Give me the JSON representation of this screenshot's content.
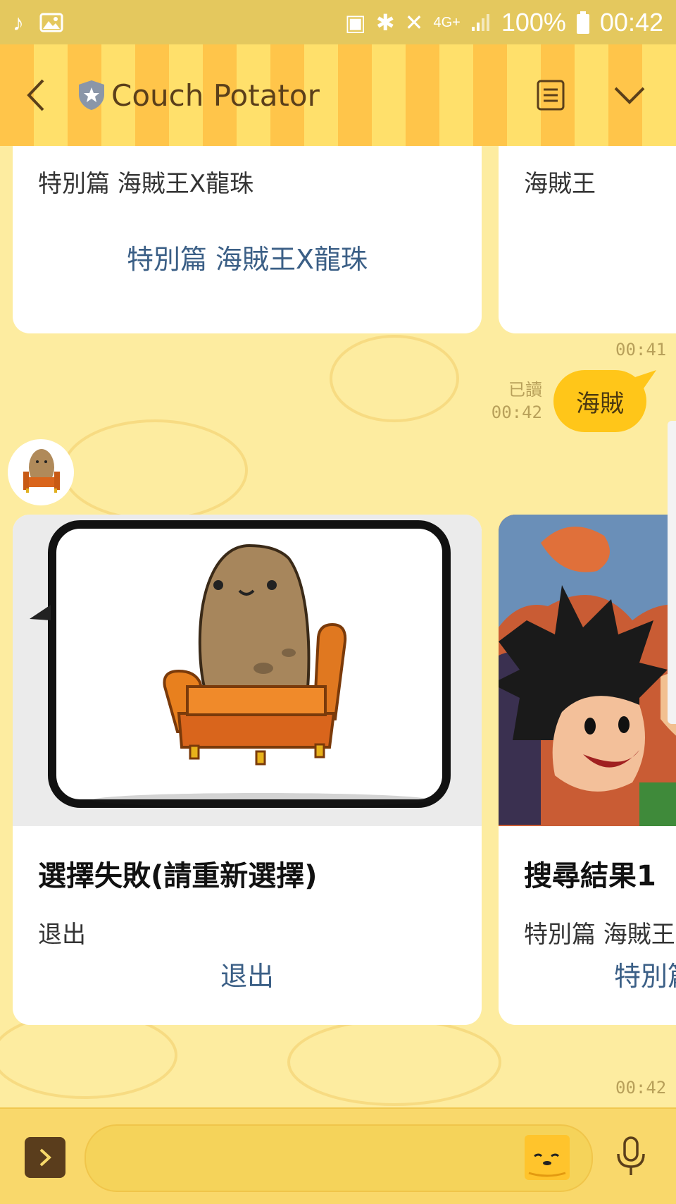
{
  "status_bar": {
    "network": "4G+",
    "battery": "100%",
    "time": "00:42"
  },
  "header": {
    "title": "Couch Potator"
  },
  "chat": {
    "top_cards": [
      {
        "text": "特別篇 海賊王X龍珠",
        "link": "特別篇 海賊王X龍珠"
      },
      {
        "text": "海賊王"
      }
    ],
    "timestamp_1": "00:41",
    "user_message": {
      "read_label": "已讀",
      "time": "00:42",
      "text": "海賊"
    },
    "carousel_cards": [
      {
        "title": "選擇失敗(請重新選擇)",
        "text": "退出",
        "link": "退出"
      },
      {
        "title": "搜尋結果1",
        "text": "特別篇 海賊王X龍珠",
        "link": "特別篇 海賊王X龍珠"
      }
    ],
    "timestamp_2": "00:42"
  },
  "colors": {
    "background": "#fdeca0",
    "status_bar": "#e4c85e",
    "bubble": "#ffc619",
    "link": "#3b5f86"
  }
}
